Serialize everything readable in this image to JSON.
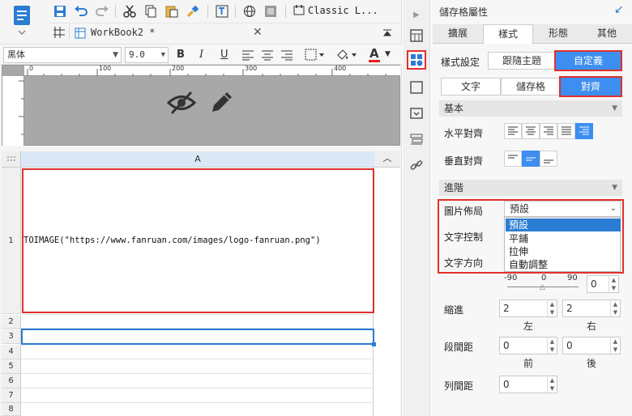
{
  "app": {
    "workbook_tab": "WorkBook2 *",
    "theme_name": "Classic L..."
  },
  "format_bar": {
    "font_name": "黑体",
    "font_size": "9.0",
    "bold": "B",
    "italic": "I",
    "underline": "U",
    "font_color_letter": "A",
    "font_color": "#e02020"
  },
  "preview": {
    "ruler_ticks": [
      "0",
      "100",
      "200",
      "300",
      "400"
    ]
  },
  "sheet": {
    "column_header": "A",
    "rows": [
      {
        "num": "1",
        "content": "TOIMAGE(\"https://www.fanruan.com/images/logo-fanruan.png\")"
      },
      {
        "num": "2",
        "content": ""
      },
      {
        "num": "3",
        "content": ""
      },
      {
        "num": "4",
        "content": ""
      },
      {
        "num": "5",
        "content": ""
      },
      {
        "num": "6",
        "content": ""
      },
      {
        "num": "7",
        "content": ""
      },
      {
        "num": "8",
        "content": ""
      }
    ]
  },
  "panel": {
    "title": "儲存格屬性",
    "tabs": [
      "擴展",
      "樣式",
      "形態",
      "其他"
    ],
    "active_tab": "樣式",
    "style_setting_label": "樣式設定",
    "follow_theme_btn": "跟隨主題",
    "custom_btn": "自定義",
    "subtabs": [
      "文字",
      "儲存格",
      "對齊"
    ],
    "basic_section": "基本",
    "h_align_label": "水平對齊",
    "v_align_label": "垂直對齊",
    "advanced_section": "進階",
    "image_layout_label": "圖片佈局",
    "image_layout_value": "預設",
    "image_layout_options": [
      "預設",
      "平鋪",
      "拉伸",
      "自動調整"
    ],
    "text_control_label": "文字控制",
    "text_direction_label": "文字方向",
    "rotation_ticks": [
      "-90",
      "0",
      "90"
    ],
    "rotation_value": "0",
    "indent_label": "縮進",
    "indent_left_value": "2",
    "indent_right_value": "2",
    "left_caption": "左",
    "right_caption": "右",
    "para_spacing_label": "段間距",
    "para_before_value": "0",
    "para_after_value": "0",
    "before_caption": "前",
    "after_caption": "後",
    "line_spacing_label": "列間距",
    "line_spacing_value": "0"
  },
  "colors": {
    "accent_blue": "#3d8ef0",
    "highlight_red": "#e0312b",
    "selection_blue": "#2b7cd3"
  }
}
